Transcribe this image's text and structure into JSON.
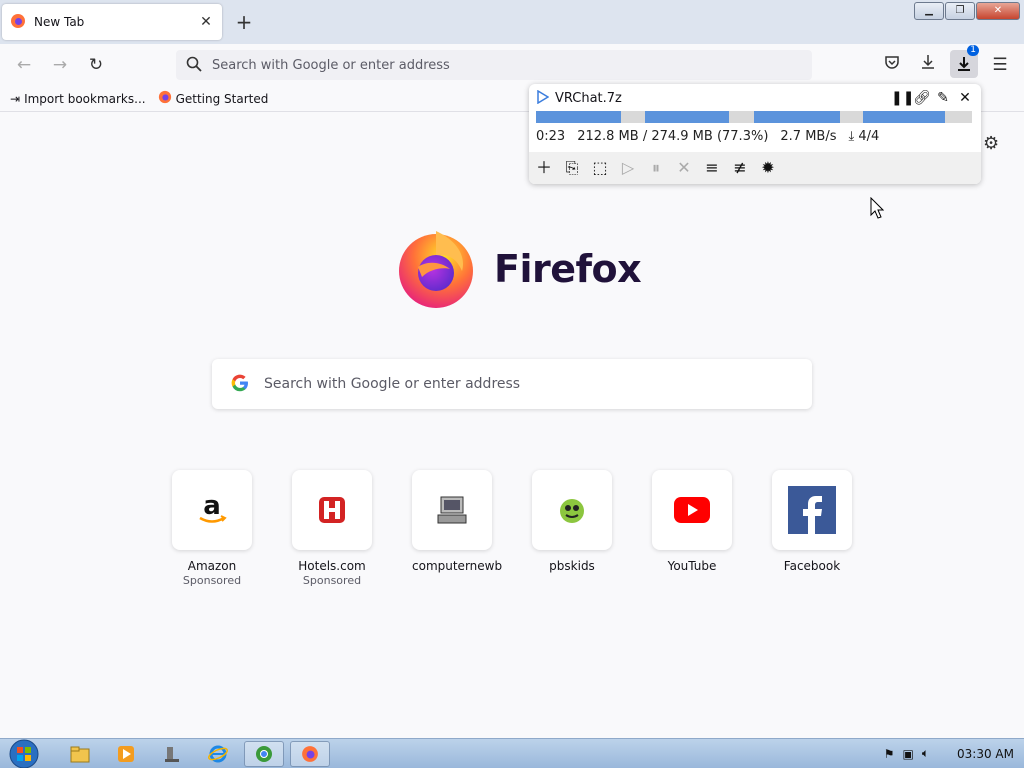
{
  "tab": {
    "title": "New Tab"
  },
  "urlbar": {
    "placeholder": "Search with Google or enter address"
  },
  "toolbar": {
    "downloads_badge": "1"
  },
  "bookmarks": [
    {
      "label": "Import bookmarks..."
    },
    {
      "label": "Getting Started"
    }
  ],
  "download": {
    "filename": "VRChat.7z",
    "elapsed": "0:23",
    "size": "212.8 MB / 274.9 MB (77.3%)",
    "speed": "2.7 MB/s",
    "connections": "4/4",
    "progress_percent": 77.3
  },
  "brand": {
    "name": "Firefox"
  },
  "search": {
    "placeholder": "Search with Google or enter address"
  },
  "top_sites": [
    {
      "label": "Amazon",
      "sub": "Sponsored"
    },
    {
      "label": "Hotels.com",
      "sub": "Sponsored"
    },
    {
      "label": "computernewb",
      "sub": ""
    },
    {
      "label": "pbskids",
      "sub": ""
    },
    {
      "label": "YouTube",
      "sub": ""
    },
    {
      "label": "Facebook",
      "sub": ""
    }
  ],
  "taskbar": {
    "clock": "03:30 AM"
  },
  "colors": {
    "accent": "#0061e0",
    "progress": "#5b93dc",
    "youtube": "#ff0000",
    "facebook": "#3b5998",
    "hotels": "#d32323"
  }
}
